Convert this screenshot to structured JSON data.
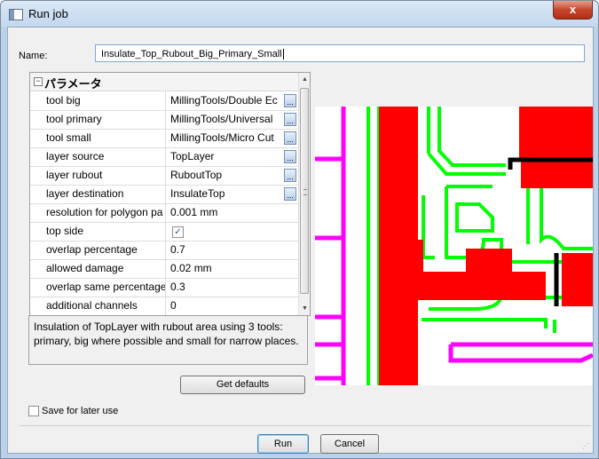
{
  "window": {
    "title": "Run job",
    "close_label": "x"
  },
  "name_field": {
    "label": "Name:",
    "value": "Insulate_Top_Rubout_Big_Primary_Small"
  },
  "properties": {
    "group_label": "パラメータ",
    "rows": [
      {
        "name": "tool big",
        "value": "MillingTools/Double Ec",
        "button": "..."
      },
      {
        "name": "tool primary",
        "value": "MillingTools/Universal",
        "button": "..."
      },
      {
        "name": "tool small",
        "value": "MillingTools/Micro Cut",
        "button": "..."
      },
      {
        "name": "layer source",
        "value": "TopLayer",
        "button": "..."
      },
      {
        "name": "layer rubout",
        "value": "RuboutTop",
        "button": "..."
      },
      {
        "name": "layer destination",
        "value": "InsulateTop",
        "button": "..."
      },
      {
        "name": "resolution for polygon pa",
        "value": "0.001 mm"
      },
      {
        "name": "top side",
        "value": "",
        "checked": true
      },
      {
        "name": "overlap percentage",
        "value": "0.7"
      },
      {
        "name": "allowed damage",
        "value": "0.02 mm"
      },
      {
        "name": "overlap same percentage",
        "value": "0.3"
      },
      {
        "name": "additional channels",
        "value": "0"
      }
    ]
  },
  "description": "Insulation of TopLayer with rubout area using 3 tools: primary, big where possible and small for narrow places.",
  "buttons": {
    "get_defaults": "Get defaults",
    "run": "Run",
    "cancel": "Cancel"
  },
  "save_for_later": {
    "label": "Save for later use",
    "checked": false
  },
  "preview_colors": {
    "copper": "#ff0000",
    "insulation": "#00ff00",
    "rubout": "#ff00ff",
    "outline": "#000000"
  }
}
